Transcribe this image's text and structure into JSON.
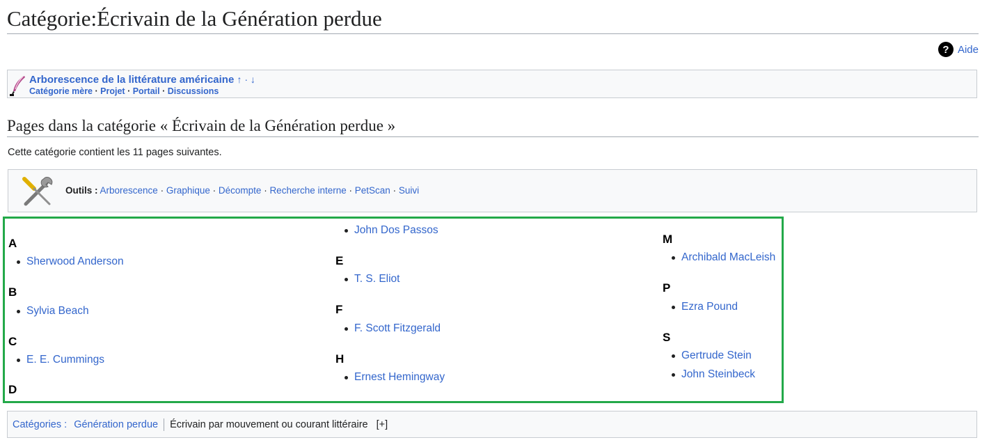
{
  "page": {
    "title": "Catégorie:Écrivain de la Génération perdue"
  },
  "help": {
    "icon": "help-question-icon",
    "label": "Aide"
  },
  "tree": {
    "icon": "quill-pen-icon",
    "title": "Arborescence de la littérature américaine",
    "arrows": "↑ · ↓",
    "links": [
      "Catégorie mère",
      "Projet",
      "Portail",
      "Discussions"
    ]
  },
  "section": {
    "heading": "Pages dans la catégorie « Écrivain de la Génération perdue »",
    "count_text": "Cette catégorie contient les 11 pages suivantes."
  },
  "tools": {
    "icon": "wrench-screwdriver-icon",
    "label": "Outils :",
    "links": [
      "Arborescence",
      "Graphique",
      "Décompte",
      "Recherche interne",
      "PetScan",
      "Suivi"
    ]
  },
  "listing": {
    "col1": [
      {
        "letter": "A",
        "pages": [
          "Sherwood Anderson"
        ]
      },
      {
        "letter": "B",
        "pages": [
          "Sylvia Beach"
        ]
      },
      {
        "letter": "C",
        "pages": [
          "E. E. Cummings"
        ]
      },
      {
        "letter": "D",
        "pages": []
      }
    ],
    "col2": [
      {
        "letter": "",
        "pages": [
          "John Dos Passos"
        ]
      },
      {
        "letter": "E",
        "pages": [
          "T. S. Eliot"
        ]
      },
      {
        "letter": "F",
        "pages": [
          "F. Scott Fitzgerald"
        ]
      },
      {
        "letter": "H",
        "pages": [
          "Ernest Hemingway"
        ]
      }
    ],
    "col3": [
      {
        "letter": "M",
        "pages": [
          "Archibald MacLeish"
        ]
      },
      {
        "letter": "P",
        "pages": [
          "Ezra Pound"
        ]
      },
      {
        "letter": "S",
        "pages": [
          "Gertrude Stein",
          "John Steinbeck"
        ]
      }
    ]
  },
  "categories": {
    "label": "Catégories :",
    "linked": "Génération perdue",
    "plain": "Écrivain par mouvement ou courant littéraire",
    "toggle": "[+]"
  }
}
